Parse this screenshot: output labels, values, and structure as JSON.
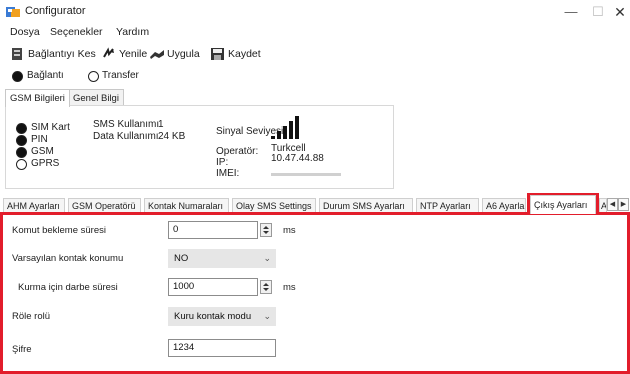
{
  "window": {
    "title": "Configurator",
    "minimize": "—",
    "maximize": "☐",
    "close": "✕"
  },
  "menu": [
    "Dosya",
    "Seçenekler",
    "Yardım"
  ],
  "toolbar": {
    "disconnect_label": "Bağlantıyı Kes",
    "refresh_label": "Yenile",
    "apply_label": "Uygula",
    "save_label": "Kaydet"
  },
  "mode": {
    "connection_label": "Bağlantı",
    "transfer_label": "Transfer",
    "selected": "Bağlantı"
  },
  "top_tabs": [
    "GSM Bilgileri",
    "Genel Bilgi"
  ],
  "gsm": {
    "statuses": [
      {
        "label": "SIM Kart",
        "on": true
      },
      {
        "label": "PIN",
        "on": true
      },
      {
        "label": "GSM",
        "on": true
      },
      {
        "label": "GPRS",
        "on": false
      }
    ],
    "sms_used_label": "SMS Kullanımı",
    "sms_used_value": "1",
    "data_used_label": "Data Kullanımı",
    "data_used_value": "24 KB",
    "signal_label": "Sinyal Seviyesi:",
    "signal_bars_active": 4,
    "signal_bars_total": 5,
    "operator_label": "Operatör:",
    "operator_value": "Turkcell",
    "ip_label": "IP:",
    "ip_value": "10.47.44.88",
    "imei_label": "IMEI:"
  },
  "bottom_tabs": [
    "AHM Ayarları",
    "GSM Operatörü",
    "Kontak Numaraları",
    "Olay SMS Settings",
    "Durum SMS Ayarları",
    "NTP Ayarları",
    "A6 Ayarları",
    "Çıkış Ayarları"
  ],
  "bottom_tab_overflow": "A",
  "active_bottom_tab": "Çıkış Ayarları",
  "output_settings": {
    "command_wait_label": "Komut bekleme süresi",
    "command_wait_value": "0",
    "command_wait_unit": "ms",
    "default_contact_label": "Varsayılan kontak konumu",
    "default_contact_value": "NO",
    "pulse_time_label": "Kurma için darbe süresi",
    "pulse_time_value": "1000",
    "pulse_time_unit": "ms",
    "relay_role_label": "Röle rolü",
    "relay_role_value": "Kuru kontak modu",
    "password_label": "Şifre",
    "password_value": "1234"
  },
  "colors": {
    "highlight": "#e21d2b",
    "select_bg": "#e6e6e6"
  }
}
